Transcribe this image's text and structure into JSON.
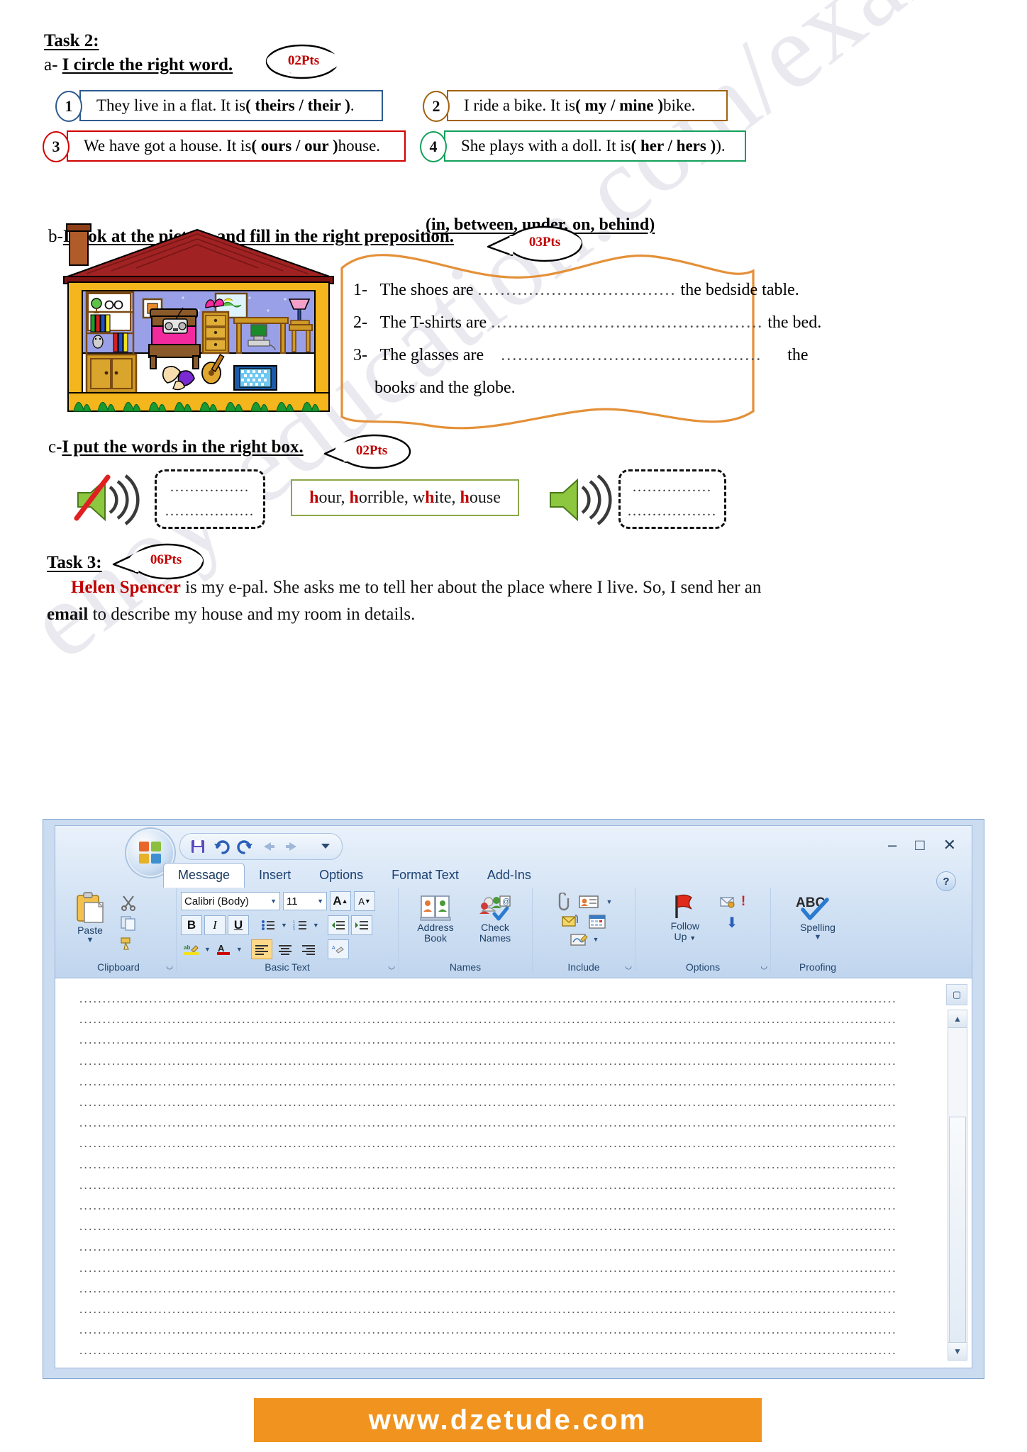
{
  "watermark_text": "enoy-education.com/exams",
  "task2": {
    "title": "Task 2:",
    "part_a": {
      "prefix": "a-",
      "instruction": "I circle the right word.",
      "points": "02Pts",
      "items": [
        {
          "num": "1",
          "pre": "They live in a flat. It is ",
          "choice": "( theirs / their )",
          "post": ".",
          "color": "#2e5a8e"
        },
        {
          "num": "2",
          "pre": "I ride a bike. It is ",
          "choice": "( my / mine )",
          "post": " bike.",
          "color": "#a2620f"
        },
        {
          "num": "3",
          "pre": "We have got a house. It is ",
          "choice": "( ours / our )",
          "post": " house.",
          "color": "#d20000"
        },
        {
          "num": "4",
          "pre": "She plays with a doll.  It is ",
          "choice": "( her / hers )",
          "post": ").",
          "color": "#13a05a"
        }
      ]
    },
    "part_b": {
      "prefix": "b-",
      "instruction": "I look at the picture and fill in the right preposition.",
      "points": "03Pts",
      "word_bank": "(in, between, under, on, behind)",
      "sentences": [
        {
          "num": "1-",
          "before": "The shoes are",
          "blank": "...................................",
          "after": "the bedside table."
        },
        {
          "num": "2-",
          "before": "The T-shirts are",
          "blank": "................................................",
          "after": "the bed."
        },
        {
          "num": "3-",
          "before": "The   glasses   are",
          "blank": "..............................................",
          "after": "the"
        },
        {
          "num": "",
          "before": "",
          "blank": "",
          "after": "books and the globe."
        }
      ]
    },
    "part_c": {
      "prefix": "c-",
      "instruction": "I put the words in the right box.",
      "points": "02Pts",
      "silent_box": {
        "line1": "................",
        "line2": "..................",
        "icon": "speaker-muted-icon"
      },
      "sound_box": {
        "line1": "................",
        "line2": "..................",
        "icon": "speaker-on-icon"
      },
      "words": [
        {
          "h": "h",
          "rest": "our, "
        },
        {
          "h": "h",
          "rest": "orrible, w"
        },
        {
          "h": "h",
          "rest": "ite, "
        },
        {
          "h": "h",
          "rest": "ouse"
        }
      ],
      "words_plain": "hour, horrible, white, house"
    }
  },
  "task3": {
    "title": "Task 3:",
    "points": "06Pts",
    "name": "Helen Spencer",
    "paragraph_1": " is my e-pal. She asks me to tell her about the place where I live. So, I send",
    "paragraph_2_a": "her an ",
    "paragraph_2_b": "email",
    "paragraph_2_c": " to describe my house and my room in details."
  },
  "outlook": {
    "quick_access": [
      "save-icon",
      "undo-icon",
      "redo-icon",
      "previous-icon",
      "next-icon",
      "customize-icon"
    ],
    "window_buttons": [
      "minimize",
      "maximize",
      "close"
    ],
    "help_label": "?",
    "tabs": [
      {
        "label": "Message",
        "active": true
      },
      {
        "label": "Insert",
        "active": false
      },
      {
        "label": "Options",
        "active": false
      },
      {
        "label": "Format Text",
        "active": false
      },
      {
        "label": "Add-Ins",
        "active": false
      }
    ],
    "groups": [
      {
        "label": "Clipboard",
        "big_button": "Paste",
        "mini_buttons": [
          "cut-icon",
          "copy-icon",
          "format-painter-icon"
        ]
      },
      {
        "label": "Basic Text",
        "font_name": "Calibri (Body)",
        "font_size": "11",
        "buttons": [
          "grow-font",
          "shrink-font",
          "bold",
          "italic",
          "underline",
          "bullets",
          "numbering",
          "decrease-indent",
          "increase-indent",
          "highlight",
          "font-color",
          "align-left",
          "align-center",
          "align-right",
          "clear-formatting"
        ],
        "bold_label": "B",
        "italic_label": "I",
        "underline_label": "U",
        "grow_label": "A",
        "shrink_label": "A",
        "highlight_label": "ab",
        "fontcolor_label": "A"
      },
      {
        "label": "Names",
        "big_buttons": [
          {
            "line1": "Address",
            "line2": "Book",
            "icon": "address-book-icon"
          },
          {
            "line1": "Check",
            "line2": "Names",
            "icon": "check-names-icon"
          }
        ]
      },
      {
        "label": "Include",
        "icons": [
          "attach-file-icon",
          "business-card-icon",
          "attach-item-icon",
          "calendar-icon",
          "signature-icon"
        ]
      },
      {
        "label": "Options",
        "big_buttons": [
          {
            "line1": "Follow",
            "line2": "Up",
            "icon": "flag-icon"
          }
        ],
        "icons": [
          "high-importance-icon",
          "permission-icon",
          "low-importance-icon"
        ]
      },
      {
        "label": "Proofing",
        "big_buttons": [
          {
            "line1": "ABC",
            "line2": "Spelling",
            "icon": "spelling-icon"
          }
        ]
      }
    ],
    "body_line": "................................................................................................................................................................................",
    "body_line_count": 22,
    "scroll": {
      "up": "▲",
      "down": "▼",
      "top_extra": "⌗"
    }
  },
  "footer": {
    "url": "www.dzetude.com",
    "bg": "#f0941f"
  }
}
